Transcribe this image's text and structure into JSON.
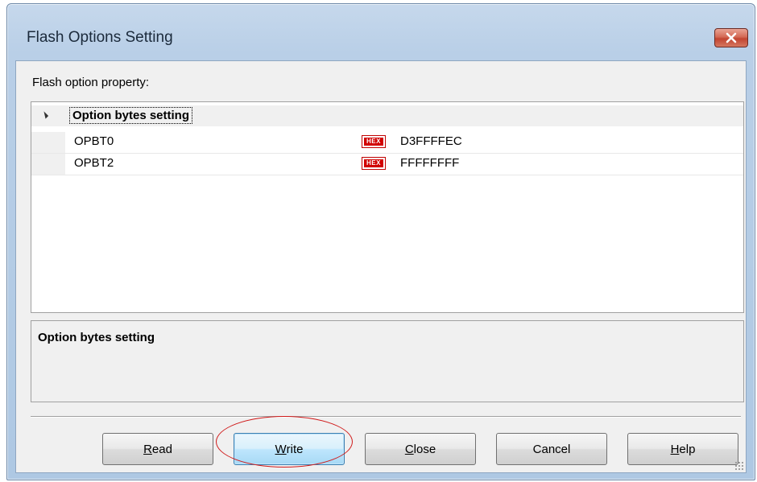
{
  "window": {
    "title": "Flash Options Setting",
    "close_icon": "close-icon"
  },
  "property_label": "Flash option property:",
  "property_label_mnemonic": "p",
  "grid": {
    "category": {
      "label": "Option bytes setting",
      "expanded": true
    },
    "items": [
      {
        "name": "OPBT0",
        "icon": "hex-icon",
        "icon_text": "HEX",
        "value": "D3FFFFEC"
      },
      {
        "name": "OPBT2",
        "icon": "hex-icon",
        "icon_text": "HEX",
        "value": "FFFFFFFF"
      }
    ]
  },
  "description": {
    "title": "Option bytes setting"
  },
  "buttons": {
    "read": {
      "mnemonic": "R",
      "rest": "ead"
    },
    "write": {
      "mnemonic": "W",
      "rest": "rite"
    },
    "close": {
      "mnemonic": "C",
      "rest": "lose"
    },
    "cancel": {
      "label": "Cancel"
    },
    "help": {
      "mnemonic": "H",
      "rest": "elp"
    }
  },
  "colors": {
    "highlight_oval": "#d01a1a",
    "hex_badge": "#d10000",
    "default_button_border": "#3c7fb1"
  }
}
